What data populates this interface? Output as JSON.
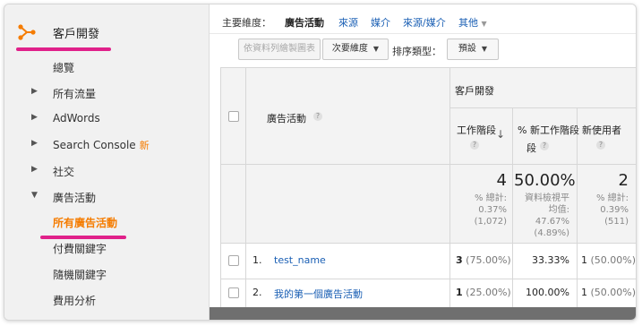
{
  "sidebar": {
    "title": "客戶開發",
    "items": [
      {
        "label": "總覽",
        "arrow": ""
      },
      {
        "label": "所有流量",
        "arrow": "▶"
      },
      {
        "label": "AdWords",
        "arrow": "▶"
      },
      {
        "label": "Search Console",
        "arrow": "▶",
        "badge": "新"
      },
      {
        "label": "社交",
        "arrow": "▶"
      },
      {
        "label": "廣告活動",
        "arrow": "▼"
      },
      {
        "label": "所有廣告活動",
        "arrow": ""
      },
      {
        "label": "付費關鍵字",
        "arrow": ""
      },
      {
        "label": "隨機關鍵字",
        "arrow": ""
      },
      {
        "label": "費用分析",
        "arrow": ""
      }
    ]
  },
  "dimensions": {
    "label": "主要維度：",
    "current": "廣告活動",
    "links": [
      "來源",
      "媒介",
      "來源/媒介"
    ],
    "more": "其他"
  },
  "toolbar": {
    "plot_rows": "依資料列繪製圖表",
    "secondary_dimension": "次要維度",
    "sort_type_label": "排序類型：",
    "sort_type_value": "預設"
  },
  "table": {
    "group_header": "客戶開發",
    "dimension_header": "廣告活動",
    "columns": [
      "工作階段",
      "% 新工作階段",
      "新使用者"
    ],
    "totals": [
      {
        "value": "4",
        "sub": [
          "% 總計:",
          "0.37%",
          "(1,072)"
        ]
      },
      {
        "value": "50.00%",
        "sub": [
          "資料檢視平",
          "均值:",
          "47.67%",
          "(4.89%)"
        ]
      },
      {
        "value": "2",
        "sub": [
          "% 總計:",
          "0.39%",
          "(511)"
        ]
      }
    ],
    "rows": [
      {
        "index": "1.",
        "name": "test_name",
        "sessions": "3",
        "sessions_pct": "(75.00%)",
        "new_pct": "33.33%",
        "new_users": "1",
        "new_users_pct": "(50.00%)"
      },
      {
        "index": "2.",
        "name": "我的第一個廣告活動",
        "sessions": "1",
        "sessions_pct": "(25.00%)",
        "new_pct": "100.00%",
        "new_users": "1",
        "new_users_pct": "(50.00%)"
      }
    ]
  },
  "colors": {
    "accent": "#f57c00",
    "underline": "#e0218a",
    "link": "#1a5fb4"
  }
}
